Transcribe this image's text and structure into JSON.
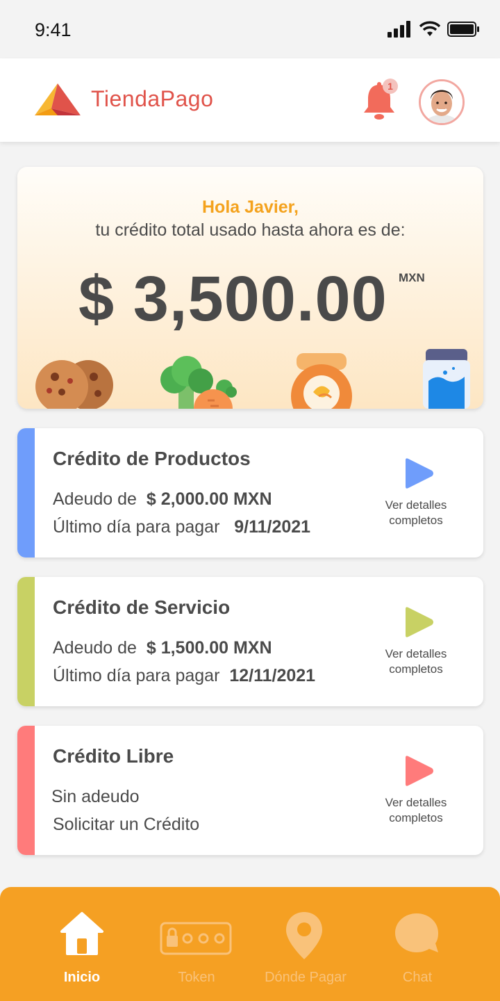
{
  "status_bar": {
    "time": "9:41"
  },
  "header": {
    "brand": "TiendaPago",
    "notification_count": "1"
  },
  "hero": {
    "greeting": "Hola Javier,",
    "subtitle": "tu crédito total usado hasta ahora es de:",
    "amount": "$ 3,500.00",
    "currency": "MXN"
  },
  "cards": [
    {
      "title": "Crédito de Productos",
      "line1_label": "Adeudo de",
      "line1_value": "$ 2,000.00 MXN",
      "line2_label": "Último día para pagar",
      "line2_value": "9/11/2021",
      "details_1": "Ver detalles",
      "details_2": "completos",
      "accent": "#6f9dfb"
    },
    {
      "title": "Crédito de Servicio",
      "line1_label": "Adeudo de",
      "line1_value": "$ 1,500.00 MXN",
      "line2_label": "Último día para pagar",
      "line2_value": "12/11/2021",
      "details_1": "Ver detalles",
      "details_2": "completos",
      "accent": "#c8d164"
    },
    {
      "title": "Crédito Libre",
      "line1_label": "Sin adeudo",
      "line2_label": "Solicitar un Crédito",
      "details_1": "Ver detalles",
      "details_2": "completos",
      "accent": "#ff7b7b"
    }
  ],
  "nav": {
    "items": [
      {
        "label": "Inicio",
        "icon": "home-icon",
        "active": true
      },
      {
        "label": "Token",
        "icon": "token-icon",
        "active": false
      },
      {
        "label": "Dónde Pagar",
        "icon": "location-pin-icon",
        "active": false
      },
      {
        "label": "Chat",
        "icon": "chat-bubble-icon",
        "active": false
      }
    ],
    "background": "#f5a023"
  }
}
